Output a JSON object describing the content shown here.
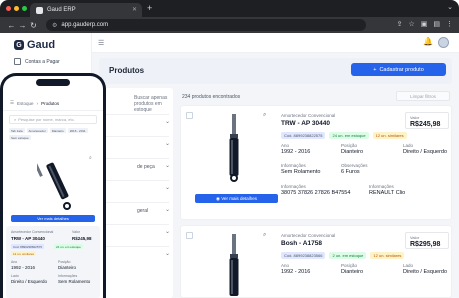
{
  "browser": {
    "tab_title": "Gaud ERP",
    "url": "app.gauderp.com",
    "traffic_colors": [
      "#ff5f57",
      "#febc2e",
      "#28c840"
    ]
  },
  "app": {
    "brand": "Gaud",
    "sidebar": {
      "items": [
        {
          "label": "Contas a Pagar",
          "icon": "payables-icon"
        }
      ]
    }
  },
  "page": {
    "title": "Produtos",
    "new_button": "Cadastrar produto"
  },
  "filters": {
    "description": "Buscar apenas produtos em estoque",
    "groups": [
      "",
      "",
      "de peça",
      "",
      "geral",
      "",
      ""
    ]
  },
  "results": {
    "count_text": "234 produtos encontrados",
    "clear_button": "Limpar filtros",
    "products": [
      {
        "category": "Amortecedor Convencional",
        "name": "TRW - AP 30440",
        "value_label": "Valor",
        "value": "R$245,98",
        "code": "Cód. 8899238822575",
        "stock": "24 un. em estoque",
        "similar": "12 un. similares",
        "year_label": "Ano",
        "year": "1992 - 2016",
        "position_label": "Posição",
        "position": "Dianteiro",
        "side_label": "Lado",
        "side": "Direito / Esquerdo",
        "info_label": "Informações",
        "info": "Sem Rolamento",
        "obs_label": "Observações",
        "obs": "6 Furos",
        "refs_label": "Informações",
        "refs": "38075  37826  27826  B47554",
        "app_label": "Informações",
        "app": "RENAULT Clio",
        "details_button": "Ver mais detalhes"
      },
      {
        "category": "Amortecedor Convencional",
        "name": "Bosh - A1758",
        "value_label": "Valor",
        "value": "R$295,98",
        "code": "Cód. 8899238823566",
        "stock": "2 un. em estoque",
        "similar": "12 un. similares",
        "year_label": "Ano",
        "year": "1992 - 2016",
        "position_label": "Posição",
        "position": "Dianteiro",
        "side_label": "Lado",
        "side": "Direito / Esquerdo"
      }
    ]
  },
  "mobile": {
    "crumb_parent": "Estoque",
    "crumb_current": "Produtos",
    "search_placeholder": "Pesquise por nome, marca, etc.",
    "chips": [
      "Tab 1ata",
      "Amortecedor",
      "Dianteiro",
      "2016 - 2011",
      "Sem estoque"
    ],
    "details_button": "Ver mais detalhes",
    "card": {
      "category": "Amortecedor Convencional",
      "name": "TRW - AP 30440",
      "value_label": "Valor",
      "value": "R$245,98",
      "code": "Cód. 8899238822575",
      "stock": "24 un. em estoque",
      "similar": "12 un. similares",
      "year_label": "Ano",
      "year": "1992 - 2016",
      "position_label": "Posição",
      "position": "Dianteiro",
      "side_label": "Lado",
      "side": "Direito / Esquerdo",
      "info_label": "Informações",
      "info": "Sem Rolamento"
    }
  }
}
